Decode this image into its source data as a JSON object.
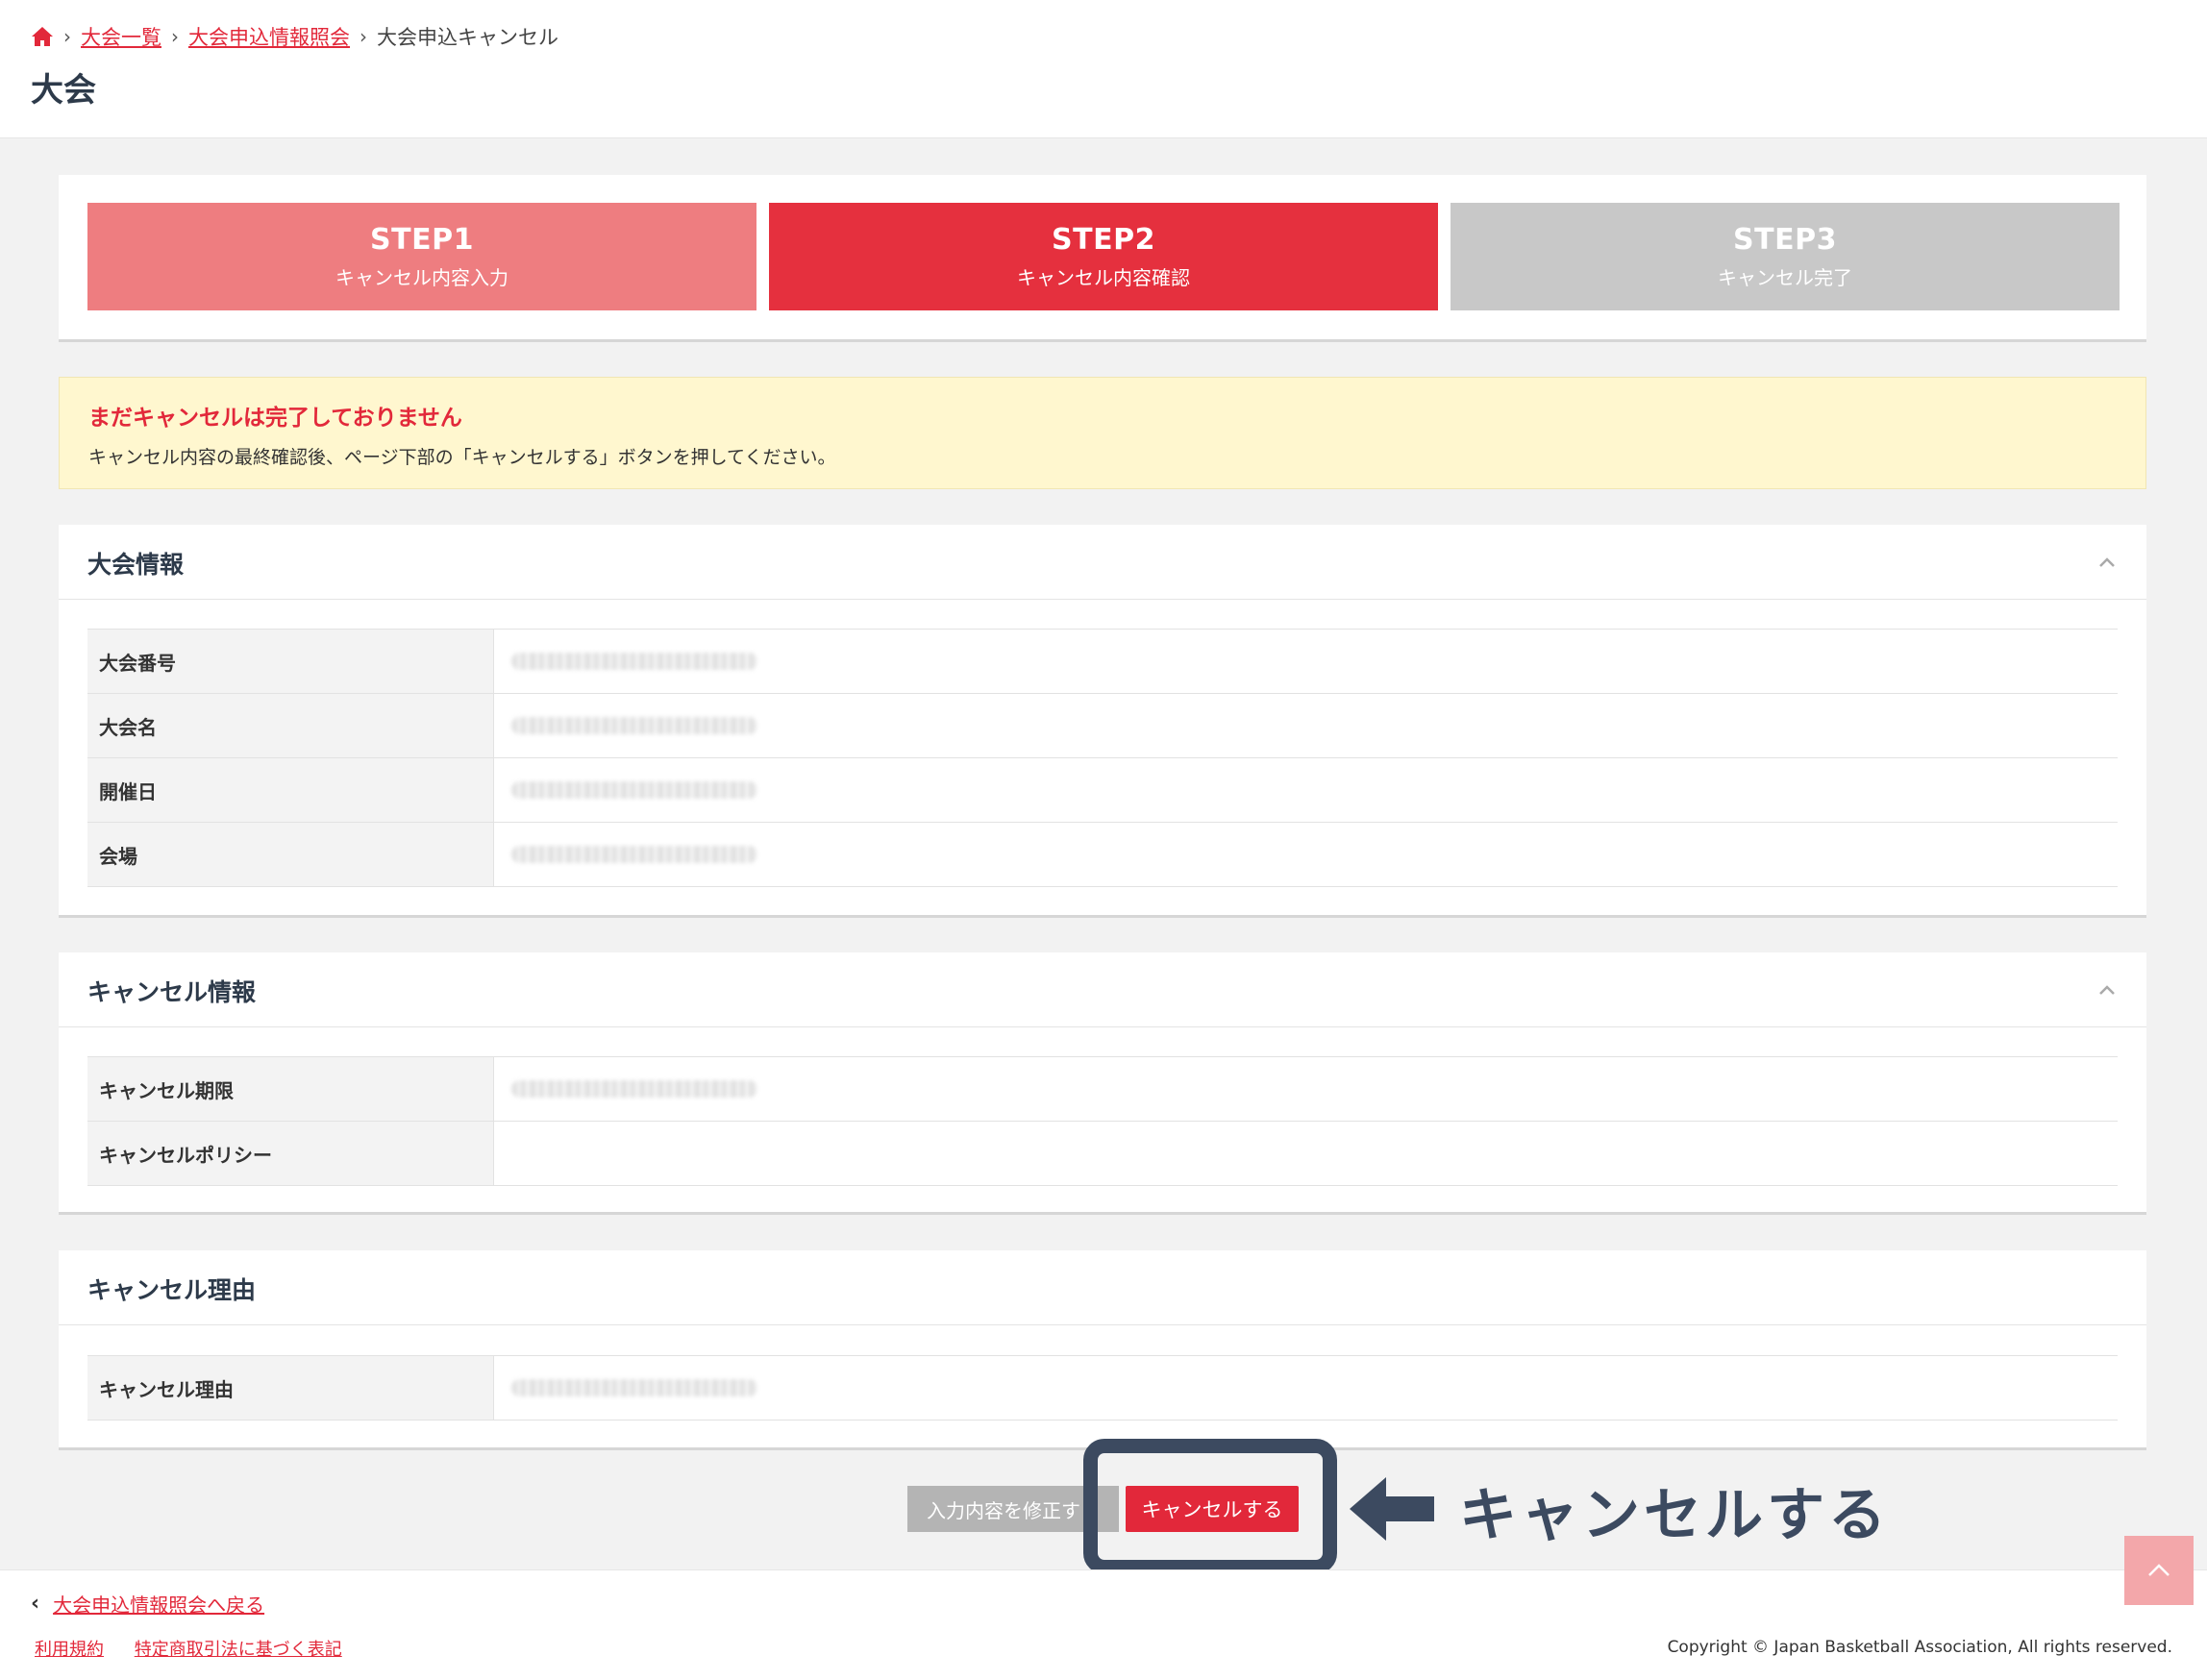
{
  "breadcrumb": {
    "home_icon": "home-icon",
    "items": [
      "大会一覧",
      "大会申込情報照会"
    ],
    "current": "大会申込キャンセル"
  },
  "page": {
    "title": "大会"
  },
  "steps": [
    {
      "num": "STEP1",
      "label": "キャンセル内容入力",
      "state": "done"
    },
    {
      "num": "STEP2",
      "label": "キャンセル内容確認",
      "state": "active"
    },
    {
      "num": "STEP3",
      "label": "キャンセル完了",
      "state": "pending"
    }
  ],
  "notice": {
    "title": "まだキャンセルは完了しておりません",
    "message": "キャンセル内容の最終確認後、ページ下部の「キャンセルする」ボタンを押してください。"
  },
  "sections": {
    "tournament": {
      "title": "大会情報",
      "rows": [
        "大会番号",
        "大会名",
        "開催日",
        "会場"
      ]
    },
    "cancel_info": {
      "title": "キャンセル情報",
      "rows": [
        "キャンセル期限",
        "キャンセルポリシー"
      ]
    },
    "cancel_reason": {
      "title": "キャンセル理由",
      "rows": [
        "キャンセル理由"
      ]
    }
  },
  "buttons": {
    "edit": "入力内容を修正す",
    "cancel": "キャンセルする"
  },
  "annotation": {
    "text": "キャンセルする"
  },
  "footer": {
    "back_link": "大会申込情報照会へ戻る",
    "links": [
      "利用規約",
      "特定商取引法に基づく表記"
    ],
    "copyright": "Copyright © Japan Basketball Association, All rights reserved."
  },
  "colors": {
    "accent": "#e2283a",
    "step_done": "#ee7d80",
    "step_active": "#e5303e",
    "step_pending": "#c8c8c8",
    "notice_bg": "#fff7cf",
    "annotation": "#3c4a60"
  }
}
